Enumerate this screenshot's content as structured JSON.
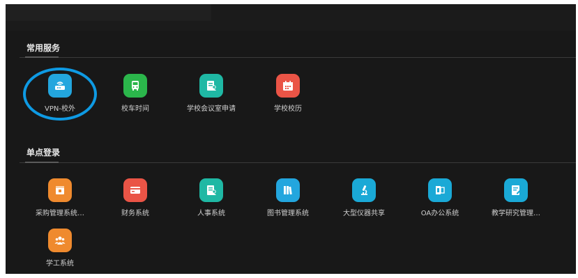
{
  "colors": {
    "teal": "#1fb8a4",
    "green": "#2bb64b",
    "blue": "#23a6de",
    "cyan": "#1aa9d6",
    "orange": "#ef8a2e",
    "red": "#ea5446",
    "highlight": "#0e9ae3"
  },
  "common_services": {
    "title": "常用服务",
    "items": [
      {
        "label": "VPN-校外",
        "icon": "router-icon"
      },
      {
        "label": "校车时间",
        "icon": "bus-icon"
      },
      {
        "label": "学校会议室申请",
        "icon": "document-user-icon"
      },
      {
        "label": "学校校历",
        "icon": "calendar-icon"
      }
    ]
  },
  "sso": {
    "title": "单点登录",
    "items": [
      {
        "label": "采购管理系统…",
        "icon": "box-icon"
      },
      {
        "label": "财务系统",
        "icon": "card-icon"
      },
      {
        "label": "人事系统",
        "icon": "document-user-icon"
      },
      {
        "label": "图书管理系统",
        "icon": "books-icon"
      },
      {
        "label": "大型仪器共享",
        "icon": "microscope-icon"
      },
      {
        "label": "OA办公系统",
        "icon": "office-icon"
      },
      {
        "label": "教学研究管理…",
        "icon": "edit-icon"
      },
      {
        "label": "学工系统",
        "icon": "group-icon"
      }
    ]
  }
}
